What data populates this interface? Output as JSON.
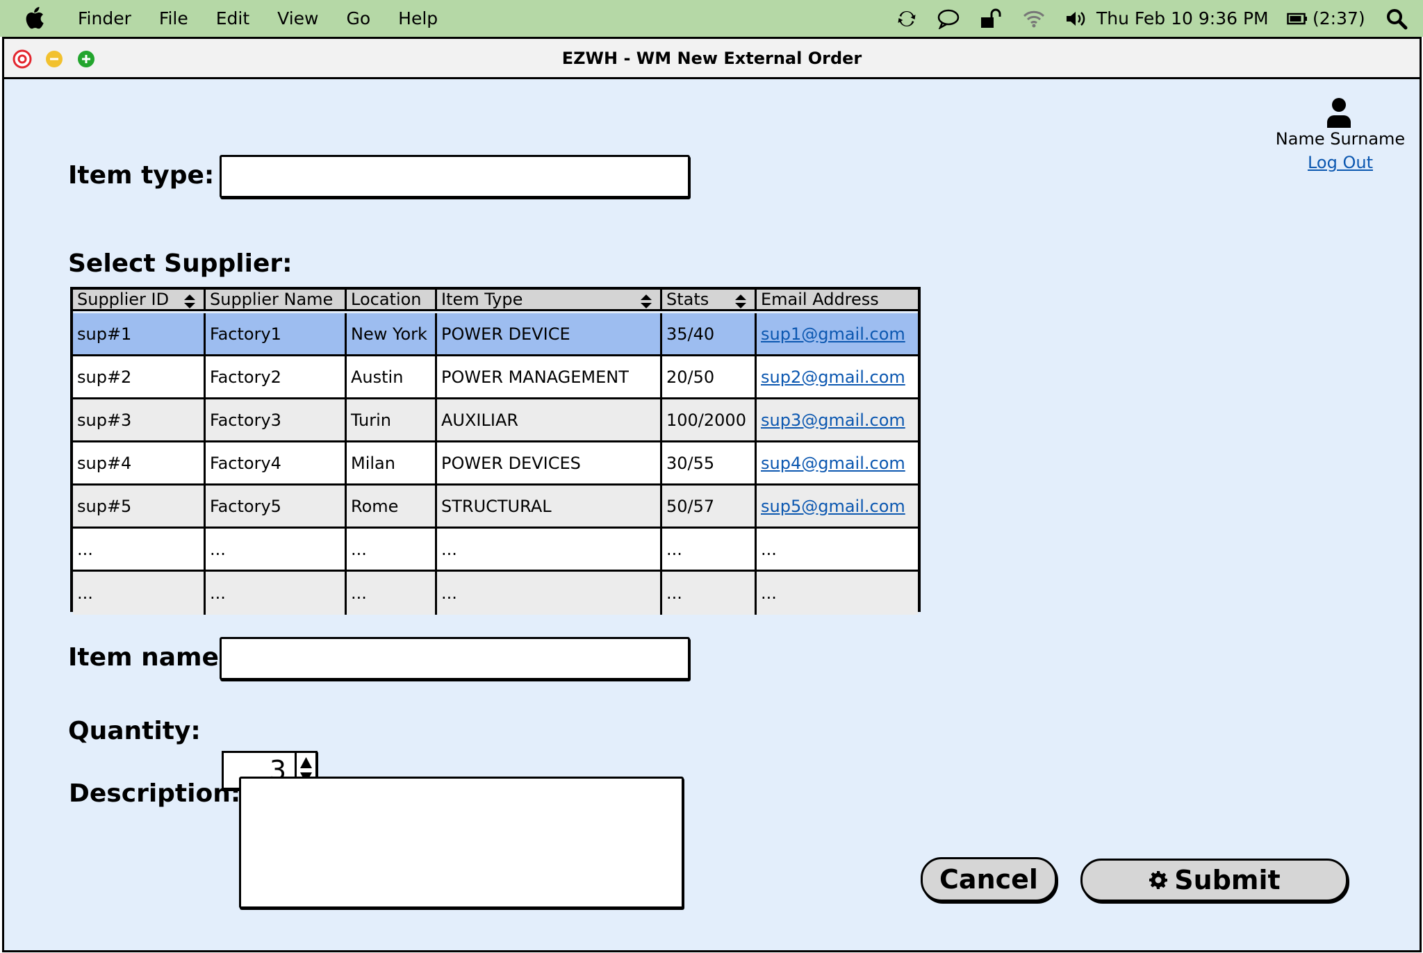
{
  "menubar": {
    "apple": "apple-icon",
    "menus": [
      "Finder",
      "File",
      "Edit",
      "View",
      "Go",
      "Help"
    ],
    "clock": "Thu Feb 10  9:36 PM",
    "battery": "(2:37)"
  },
  "window": {
    "title": "EZWH - WM New External Order"
  },
  "user": {
    "name": "Name Surname",
    "logout": "Log Out"
  },
  "form": {
    "item_type_label": "Item type:",
    "item_type_value": "",
    "select_supplier_label": "Select Supplier:",
    "item_name_label": "Item name:",
    "item_name_value": "",
    "quantity_label": "Quantity:",
    "quantity_value": "3",
    "description_label": "Description:",
    "description_value": ""
  },
  "table": {
    "headers": [
      "Supplier ID",
      "Supplier Name",
      "Location",
      "Item Type",
      "Stats",
      "Email Address"
    ],
    "rows": [
      [
        "sup#1",
        "Factory1",
        "New York",
        "POWER DEVICE",
        "35/40",
        "sup1@gmail.com"
      ],
      [
        "sup#2",
        " Factory2",
        "Austin",
        "POWER MANAGEMENT",
        "20/50",
        "sup2@gmail.com"
      ],
      [
        "sup#3",
        " Factory3",
        "Turin",
        "AUXILIAR",
        "100/2000",
        "sup3@gmail.com"
      ],
      [
        "sup#4",
        " Factory4",
        "Milan",
        "POWER DEVICES",
        "30/55",
        "sup4@gmail.com"
      ],
      [
        "sup#5",
        " Factory5",
        "Rome",
        "STRUCTURAL",
        "50/57",
        "sup5@gmail.com"
      ],
      [
        "...",
        "...",
        "...",
        "...",
        "...",
        "..."
      ],
      [
        "...",
        "...",
        "...",
        "...",
        "...",
        "..."
      ]
    ]
  },
  "buttons": {
    "cancel": "Cancel",
    "submit": "Submit"
  },
  "colors": {
    "menubar": "#b5d8a6",
    "window_bg": "#e3eefb",
    "selected_row": "#9dbdf0",
    "link": "#0b57b0"
  }
}
